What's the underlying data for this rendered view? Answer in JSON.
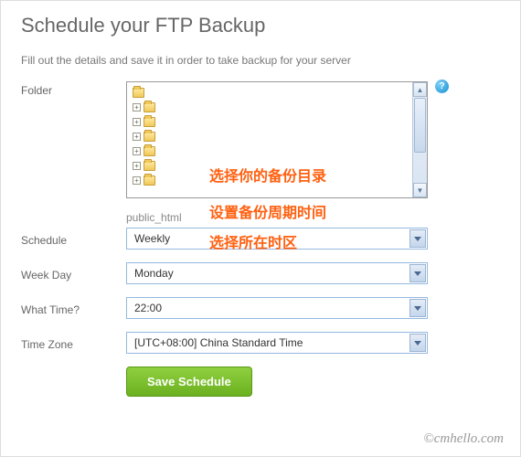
{
  "title": "Schedule your FTP Backup",
  "subtitle": "Fill out the details and save it in order to take backup for your server",
  "labels": {
    "folder": "Folder",
    "schedule": "Schedule",
    "weekday": "Week Day",
    "whattime": "What Time?",
    "timezone": "Time Zone"
  },
  "folder_path": "public_html",
  "help_icon": "?",
  "fields": {
    "schedule": "Weekly",
    "weekday": "Monday",
    "whattime": "22:00",
    "timezone": "[UTC+08:00] China Standard Time"
  },
  "annotations": {
    "a1": "选择你的备份目录",
    "a2": "设置备份周期时间",
    "a3": "选择所在时区"
  },
  "save_button": "Save Schedule",
  "watermark": "©cmhello.com",
  "scroll": {
    "up": "▲",
    "down": "▼"
  },
  "expand_glyph": "+"
}
